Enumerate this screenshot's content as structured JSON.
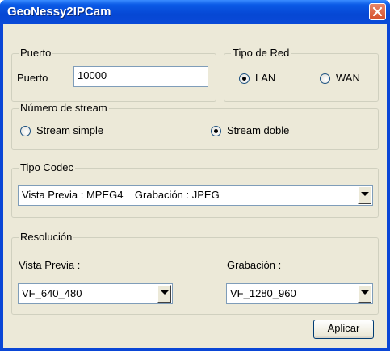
{
  "window": {
    "title": "GeoNessy2IPCam"
  },
  "puerto": {
    "group_label": "Puerto",
    "field_label": "Puerto",
    "value": "10000"
  },
  "tipo_red": {
    "group_label": "Tipo de Red",
    "options": [
      "LAN",
      "WAN"
    ],
    "selected": "LAN"
  },
  "stream": {
    "group_label": "Número de stream",
    "options": [
      "Stream simple",
      "Stream doble"
    ],
    "selected": "Stream doble"
  },
  "codec": {
    "group_label": "Tipo Codec",
    "value": "Vista Previa : MPEG4    Grabación : JPEG"
  },
  "resolucion": {
    "group_label": "Resolución",
    "preview_label": "Vista Previa :",
    "preview_value": "VF_640_480",
    "record_label": "Grabación :",
    "record_value": "VF_1280_960"
  },
  "actions": {
    "apply_label": "Aplicar"
  },
  "colors": {
    "titlebar": "#0a4ad8",
    "close_button": "#d6502b",
    "dialog_bg": "#ece9d8"
  }
}
